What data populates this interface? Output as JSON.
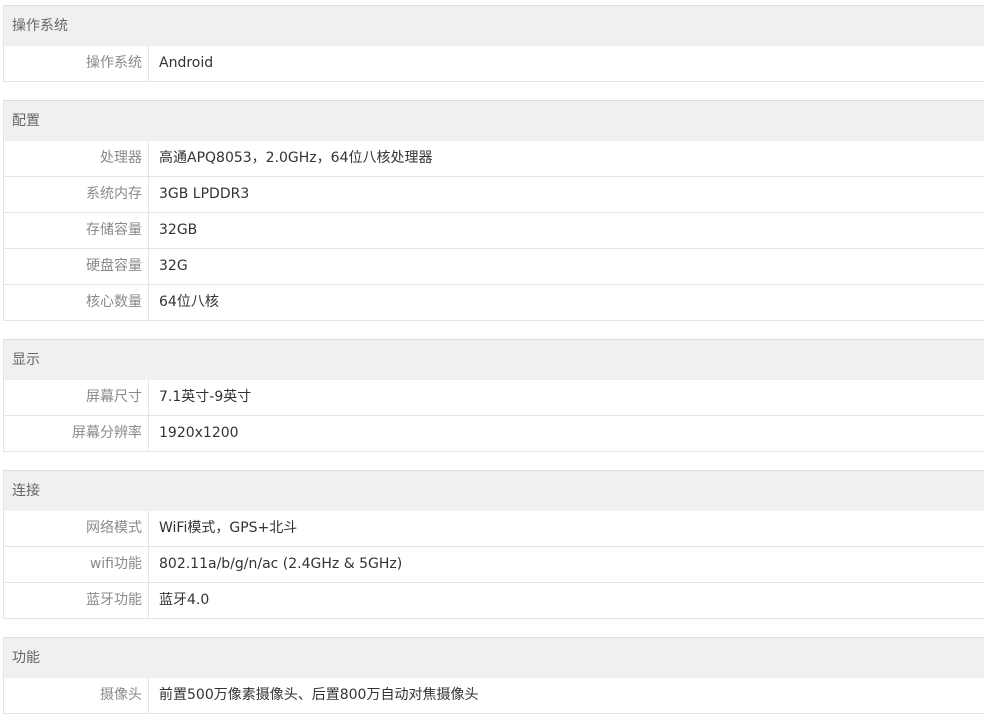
{
  "sections": [
    {
      "title": "操作系统",
      "rows": [
        {
          "label": "操作系统",
          "value": "Android"
        }
      ]
    },
    {
      "title": "配置",
      "rows": [
        {
          "label": "处理器",
          "value": "高通APQ8053，2.0GHz，64位八核处理器"
        },
        {
          "label": "系统内存",
          "value": "3GB LPDDR3"
        },
        {
          "label": "存储容量",
          "value": "32GB"
        },
        {
          "label": "硬盘容量",
          "value": "32G"
        },
        {
          "label": "核心数量",
          "value": "64位八核"
        }
      ]
    },
    {
      "title": "显示",
      "rows": [
        {
          "label": "屏幕尺寸",
          "value": "7.1英寸-9英寸"
        },
        {
          "label": "屏幕分辨率",
          "value": "1920x1200"
        }
      ]
    },
    {
      "title": "连接",
      "rows": [
        {
          "label": "网络模式",
          "value": "WiFi模式，GPS+北斗"
        },
        {
          "label": "wifi功能",
          "value": "802.11a/b/g/n/ac (2.4GHz & 5GHz)"
        },
        {
          "label": "蓝牙功能",
          "value": "蓝牙4.0"
        }
      ]
    },
    {
      "title": "功能",
      "rows": [
        {
          "label": "摄像头",
          "value": "前置500万像素摄像头、后置800万自动对焦摄像头"
        }
      ]
    }
  ]
}
